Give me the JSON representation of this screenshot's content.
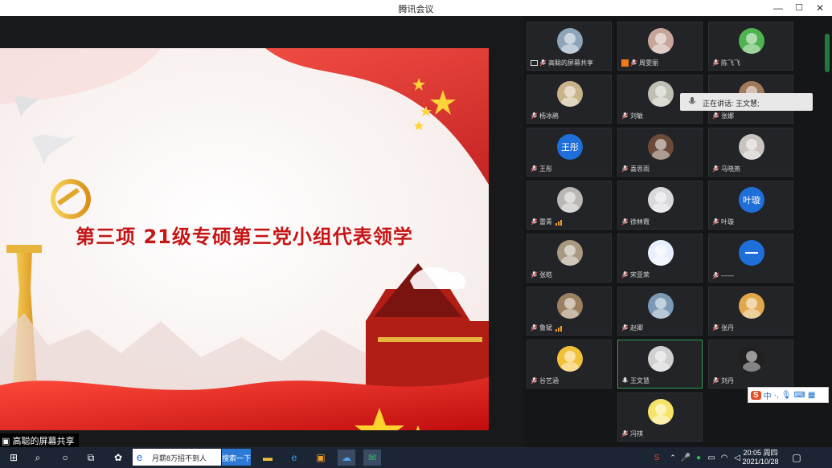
{
  "window": {
    "title": "腾讯会议"
  },
  "slide": {
    "title": "第三项  21级专硕第三党小组代表领学"
  },
  "share_label": "高聪的屏幕共享",
  "speaking": {
    "text": "正在讲话: 王文慧;"
  },
  "participants": [
    {
      "name": "高聪的屏幕共享"
    },
    {
      "name": "周雯丽"
    },
    {
      "name": "陈飞飞"
    },
    {
      "name": "杨冰鹃"
    },
    {
      "name": "刘敏"
    },
    {
      "name": "张娜"
    },
    {
      "name": "王彤",
      "avatar_text": "王彤"
    },
    {
      "name": "喜思雨"
    },
    {
      "name": "马晓燕"
    },
    {
      "name": "雷青"
    },
    {
      "name": "徐林霞"
    },
    {
      "name": "叶璇",
      "avatar_text": "叶璇"
    },
    {
      "name": "张皓"
    },
    {
      "name": "宋亚荣"
    },
    {
      "name": "——"
    },
    {
      "name": "鲁斌"
    },
    {
      "name": "赵卿"
    },
    {
      "name": "张丹"
    },
    {
      "name": "谷艺涵"
    },
    {
      "name": "王文慧"
    },
    {
      "name": "刘丹"
    },
    {
      "name": "冯祺"
    }
  ],
  "ime": {
    "label": "中"
  },
  "taskbar": {
    "search_text": "月薪8万招不到人",
    "search_button": "搜索一下",
    "time": "20:05 周四",
    "date": "2021/10/28"
  },
  "colors": {
    "accent_green": "#2d9f54",
    "slide_red": "#c51515"
  }
}
